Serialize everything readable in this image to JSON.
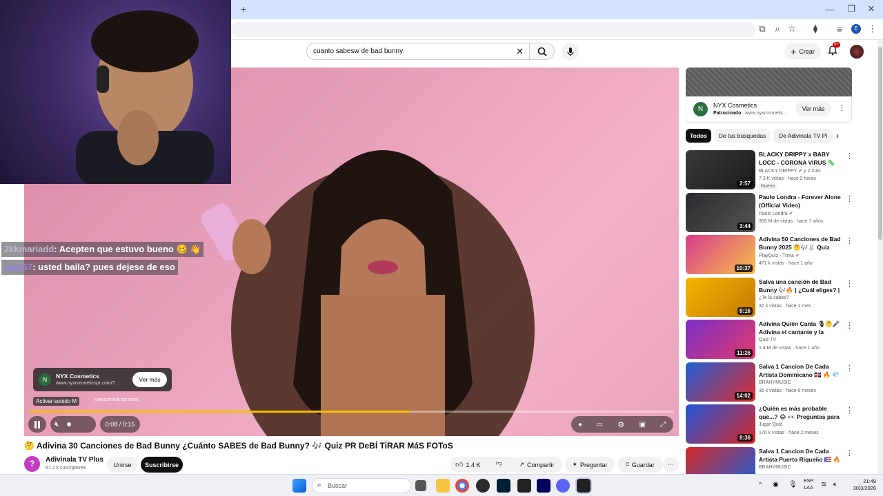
{
  "browser": {
    "new_tab_label": "+",
    "minimize_label": "—",
    "restore_label": "❐",
    "close_label": "✕",
    "profile_initial": "E"
  },
  "youtube_header": {
    "search_value": "cuanto sabesw de bad bunny",
    "create_label": "Crear",
    "notifications_count": "9+"
  },
  "stream_overlay": {
    "chat": [
      {
        "user": "2kkmariadd",
        "message": ": Acepten que estuvo bueno 🥴 👋"
      },
      {
        "user": "jgg167",
        "message": ": usted baila? pues dejese de eso"
      }
    ]
  },
  "player": {
    "ad": {
      "advertiser": "NYX Cosmetics",
      "url": "www.nyxcosmeticspr.com/?...",
      "cta": "Ver más",
      "avatar_letter": "N",
      "unmute_tooltip": "Activar sonido  M",
      "footer_url": "nyxcosmeticspr.com/"
    },
    "progress_percent": 59,
    "time": "0:08 / 0:15"
  },
  "video": {
    "title": "🤔 Adivina 30 Canciones de Bad Bunny ¿Cuánto SABES de Bad Bunny? 🎶 Quiz PR DeBÍ TiRAR MáS FOToS",
    "channel_name": "Adivinala TV Plus",
    "subscribers": "67.2 k suscriptores",
    "join_label": "Unirse",
    "subscribe_label": "Suscribirse",
    "likes": "1.4 K",
    "share_label": "Compartir",
    "ask_label": "Preguntar",
    "save_label": "Guardar"
  },
  "sidebar": {
    "sponsored": {
      "name": "NYX Cosmetics",
      "label": "Patrocinado",
      "url": "www.nyxcosmetic...",
      "cta": "Ver más",
      "avatar_letter": "N"
    },
    "chips": [
      "Todos",
      "De tus búsquedas",
      "De Adivinala TV Pl"
    ],
    "recommendations": [
      {
        "title": "BLACKY DRIPPY x BABY LOCC - CORONA VIRUS 🦠 (Shot. By ...",
        "channel": "BLACKY DRIPPY ✔ y 2 más",
        "meta": "7.3 K vistas · hace 2 horas",
        "duration": "2:57",
        "badge": "Nuevo",
        "colors": [
          "#3a3a3a",
          "#1a1a1a"
        ]
      },
      {
        "title": "Paulo Londra - Forever Alone (Official Video)",
        "channel": "Paulo Londra ✔",
        "meta": "300 M de vistas · hace 7 años",
        "duration": "3:44",
        "badge": "",
        "colors": [
          "#2b2b30",
          "#555"
        ]
      },
      {
        "title": "Adivina 50 Canciones de Bad Bunny 2025 🤔🎶🐰 Quiz Music ...",
        "channel": "PlayQuiz - Trivia ✔",
        "meta": "471 k vistas · hace 1 año",
        "duration": "10:37",
        "badge": "",
        "colors": [
          "#d93b8c",
          "#f5c04a"
        ]
      },
      {
        "title": "Salva una canción de Bad Bunny 🎶🔥 | ¿Cuál eliges? | ...",
        "channel": "¿Te la sabes?",
        "meta": "32 k vistas · hace 1 mes",
        "duration": "8:16",
        "badge": "",
        "colors": [
          "#f5b400",
          "#c47a00"
        ]
      },
      {
        "title": "Adivina Quién Canta 🎙🤔🎤 Adivina el cantante y la canció...",
        "channel": "Quiz TV",
        "meta": "1.4 M de vistas · hace 1 año",
        "duration": "11:26",
        "badge": "",
        "colors": [
          "#7a2fc9",
          "#e23a6a"
        ]
      },
      {
        "title": "Salva 1 Cancion De Cada Artista Dominicano 🇩🇴 🔥 💎 ¿Cual E...",
        "channel": "BRAHYMUSIC",
        "meta": "35 k vistas · hace 6 meses",
        "duration": "14:02",
        "badge": "",
        "colors": [
          "#1e5fd6",
          "#e02b2b"
        ]
      },
      {
        "title": "¿Quién es más probable que...? 😂 👀 Preguntas para AMIGOS",
        "channel": "Jugar Quiz",
        "meta": "170 k vistas · hace 2 meses",
        "duration": "8:36",
        "badge": "",
        "colors": [
          "#2057d8",
          "#d62828"
        ]
      },
      {
        "title": "Salva 1 Cancion De Cada Artista Puerto Riqueño 🇵🇷 🔥 💎 ...",
        "channel": "BRAHYMUSIC",
        "meta": "",
        "duration": "",
        "badge": "",
        "colors": [
          "#d62828",
          "#1e5fd6"
        ]
      }
    ]
  },
  "taskbar": {
    "search_placeholder": "Buscar",
    "lang": "ESP",
    "region": "LAA",
    "time": "21:49",
    "date": "30/3/2026"
  }
}
